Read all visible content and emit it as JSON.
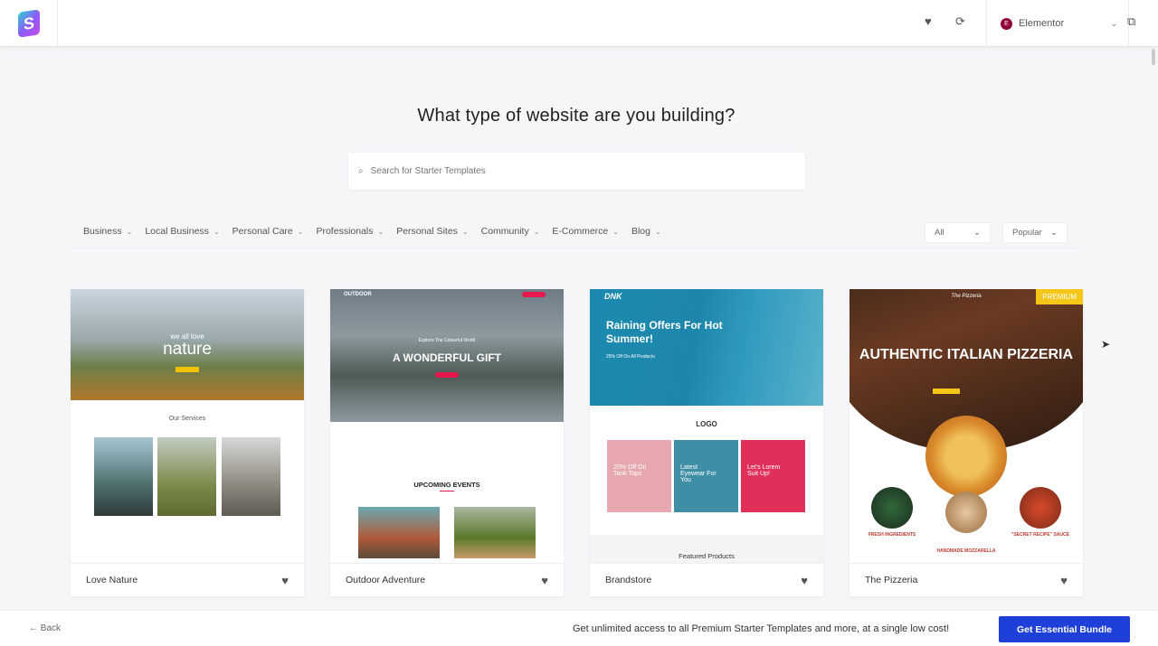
{
  "header": {
    "builder": "Elementor",
    "builder_badge": "E",
    "logo": "S"
  },
  "page": {
    "title": "What type of website are you building?",
    "search_placeholder": "Search for Starter Templates"
  },
  "categories": [
    "Business",
    "Local Business",
    "Personal Care",
    "Professionals",
    "Personal Sites",
    "Community",
    "E-Commerce",
    "Blog"
  ],
  "filters": {
    "type": "All",
    "sort": "Popular"
  },
  "cards": [
    {
      "name": "Love Nature",
      "hero_small": "we all love",
      "hero": "nature",
      "section": "Our Services"
    },
    {
      "name": "Outdoor Adventure",
      "logo": "OUTDOOR",
      "tagline": "Explore The Colourful World",
      "hero": "A WONDERFUL GIFT",
      "section": "UPCOMING EVENTS"
    },
    {
      "name": "Brandstore",
      "logo": "DNK",
      "hero": "Raining Offers For Hot Summer!",
      "sub": "25% Off On All Products",
      "brand": "LOGO",
      "promos": [
        "20% Off On Tank Tops",
        "Latest Eyewear For You",
        "Let's Lorem Suit Up!"
      ],
      "section": "Featured Products"
    },
    {
      "name": "The Pizzeria",
      "badge": "PREMIUM",
      "logo": "The Pizzeria",
      "hero": "AUTHENTIC ITALIAN PIZZERIA",
      "features": [
        "FRESH INGREDIENTS",
        "HANDMADE MOZZARELLA",
        "\"SECRET RECIPE\" SAUCE"
      ]
    }
  ],
  "footer": {
    "back": "Back",
    "promo": "Get unlimited access to all Premium Starter Templates and more, at a single low cost!",
    "cta": "Get Essential Bundle"
  },
  "colors": {
    "accent": "#1e40d8",
    "premium": "#f5c518",
    "elementor": "#92003b"
  }
}
